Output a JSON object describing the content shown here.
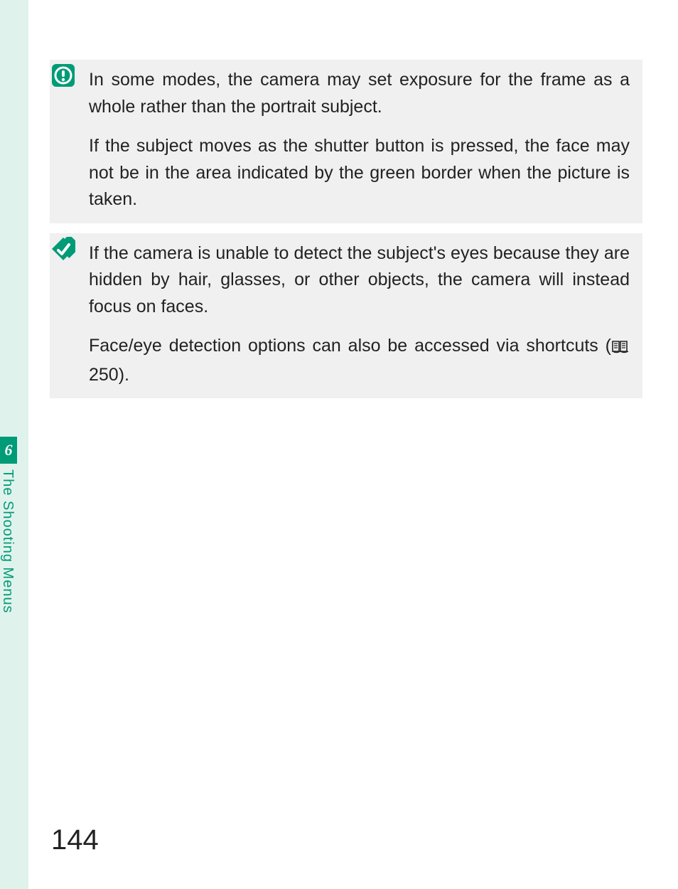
{
  "chapter": {
    "number": "6",
    "title": "The Shooting Menus"
  },
  "page_number": "144",
  "caution_box": {
    "icon_name": "caution-icon",
    "paragraphs": [
      "In some modes, the camera may set exposure for the frame as a whole rather than the portrait subject.",
      "If the subject moves as the shutter button is pressed, the face may not be in the area indicated by the green border when the picture is taken."
    ]
  },
  "tip_box": {
    "icon_name": "tip-icon",
    "paragraphs": [
      "If the camera is unable to detect the subject's eyes because they are hidden by hair, glasses, or other objects, the camera will instead focus on faces.",
      "Face/eye detection options can also be accessed via shortcuts (   250)."
    ],
    "page_ref_icon": "page-ref-icon",
    "page_ref_number": "250",
    "p2_prefix": "Face/eye detection options can also be accessed via shortcuts (",
    "p2_suffix": " 250)."
  },
  "colors": {
    "accent": "#009b77",
    "box_bg": "#eff0ef",
    "strip_bg": "#e0f2ec"
  }
}
